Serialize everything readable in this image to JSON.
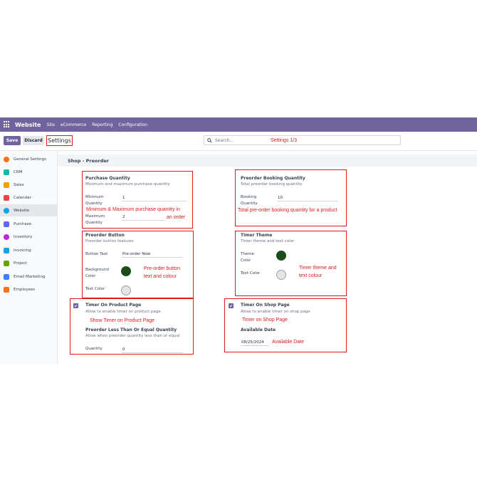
{
  "topnav": {
    "brand": "Website",
    "links": [
      "Site",
      "eCommerce",
      "Reporting",
      "Configuration"
    ]
  },
  "control": {
    "save": "Save",
    "discard": "Discard",
    "breadcrumb": "Settings",
    "search_placeholder": "Search...",
    "settings_page_note": "Settings 1/3"
  },
  "sidebar": {
    "items": [
      {
        "label": "General Settings",
        "icon": "gear-icon",
        "color": "#f97316"
      },
      {
        "label": "CRM",
        "icon": "crm-icon",
        "color": "#14b8a6"
      },
      {
        "label": "Sales",
        "icon": "sales-icon",
        "color": "#f59e0b"
      },
      {
        "label": "Calendar",
        "icon": "calendar-icon",
        "color": "#ef4444"
      },
      {
        "label": "Website",
        "icon": "globe-icon",
        "color": "#0ea5e9"
      },
      {
        "label": "Purchase",
        "icon": "purchase-icon",
        "color": "#6366f1"
      },
      {
        "label": "Inventory",
        "icon": "inventory-icon",
        "color": "#c026d3"
      },
      {
        "label": "Invoicing",
        "icon": "invoice-icon",
        "color": "#0ea5e9"
      },
      {
        "label": "Project",
        "icon": "check-icon",
        "color": "#65a30d"
      },
      {
        "label": "Email Marketing",
        "icon": "email-icon",
        "color": "#3b82f6"
      },
      {
        "label": "Employees",
        "icon": "employees-icon",
        "color": "#f97316"
      }
    ],
    "active_index": 4
  },
  "section": {
    "title": "Shop - Preorder"
  },
  "purchase_quantity": {
    "title": "Purchase Quantity",
    "desc": "Minimum and maximum purchase quantity",
    "min_label": "Minimum Quantity",
    "min_value": "1",
    "max_label": "Maximum Quantity",
    "max_value": "2",
    "annotation_1": "Minimum & Maximum purchase quantity in",
    "annotation_2": "an order"
  },
  "booking_quantity": {
    "title": "Preorder Booking Quantity",
    "desc": "Total preorder booking quantity",
    "label": "Booking Quantity",
    "value": "10",
    "annotation": "Total pre-order booking quantity for a product"
  },
  "preorder_button": {
    "title": "Preorder Button",
    "desc": "Preorder button features",
    "text_label": "Button Text",
    "text_value": "Pre-order Now",
    "bg_label": "Background Color",
    "bg_color": "#1b4d1b",
    "text_color_label": "Text Color",
    "text_color": "#e5e3e3",
    "annotation_1": "Pre-order button",
    "annotation_2": "text and colour"
  },
  "timer_theme": {
    "title": "Timer Theme",
    "desc": "Timer theme and text color",
    "theme_label": "Theme Color",
    "theme_color": "#1b4d1b",
    "text_label": "Text Color",
    "text_color": "#e5e3e3",
    "annotation_1": "Timer theme and",
    "annotation_2": "text colour"
  },
  "timer_product": {
    "checked": true,
    "title": "Timer On Product Page",
    "desc": "Allow to enable timer on product page",
    "annotation": "Show Timer on Product Page",
    "sub_title": "Preorder Less Than Or Equal Quantity",
    "sub_desc": "Allow when preorder quantity less than or equal",
    "qty_label": "Quantity",
    "qty_value": "0"
  },
  "timer_shop": {
    "checked": true,
    "title": "Timer On Shop Page",
    "desc": "Allow to enable timer on shop page",
    "annotation": "Timer on Shop Page",
    "date_title": "Available Date",
    "date_value": "08/25/2024",
    "date_annotation": "Available Date"
  },
  "colors": {
    "nav": "#71639e",
    "accent": "#71639e",
    "annotation": "#e0191c"
  }
}
